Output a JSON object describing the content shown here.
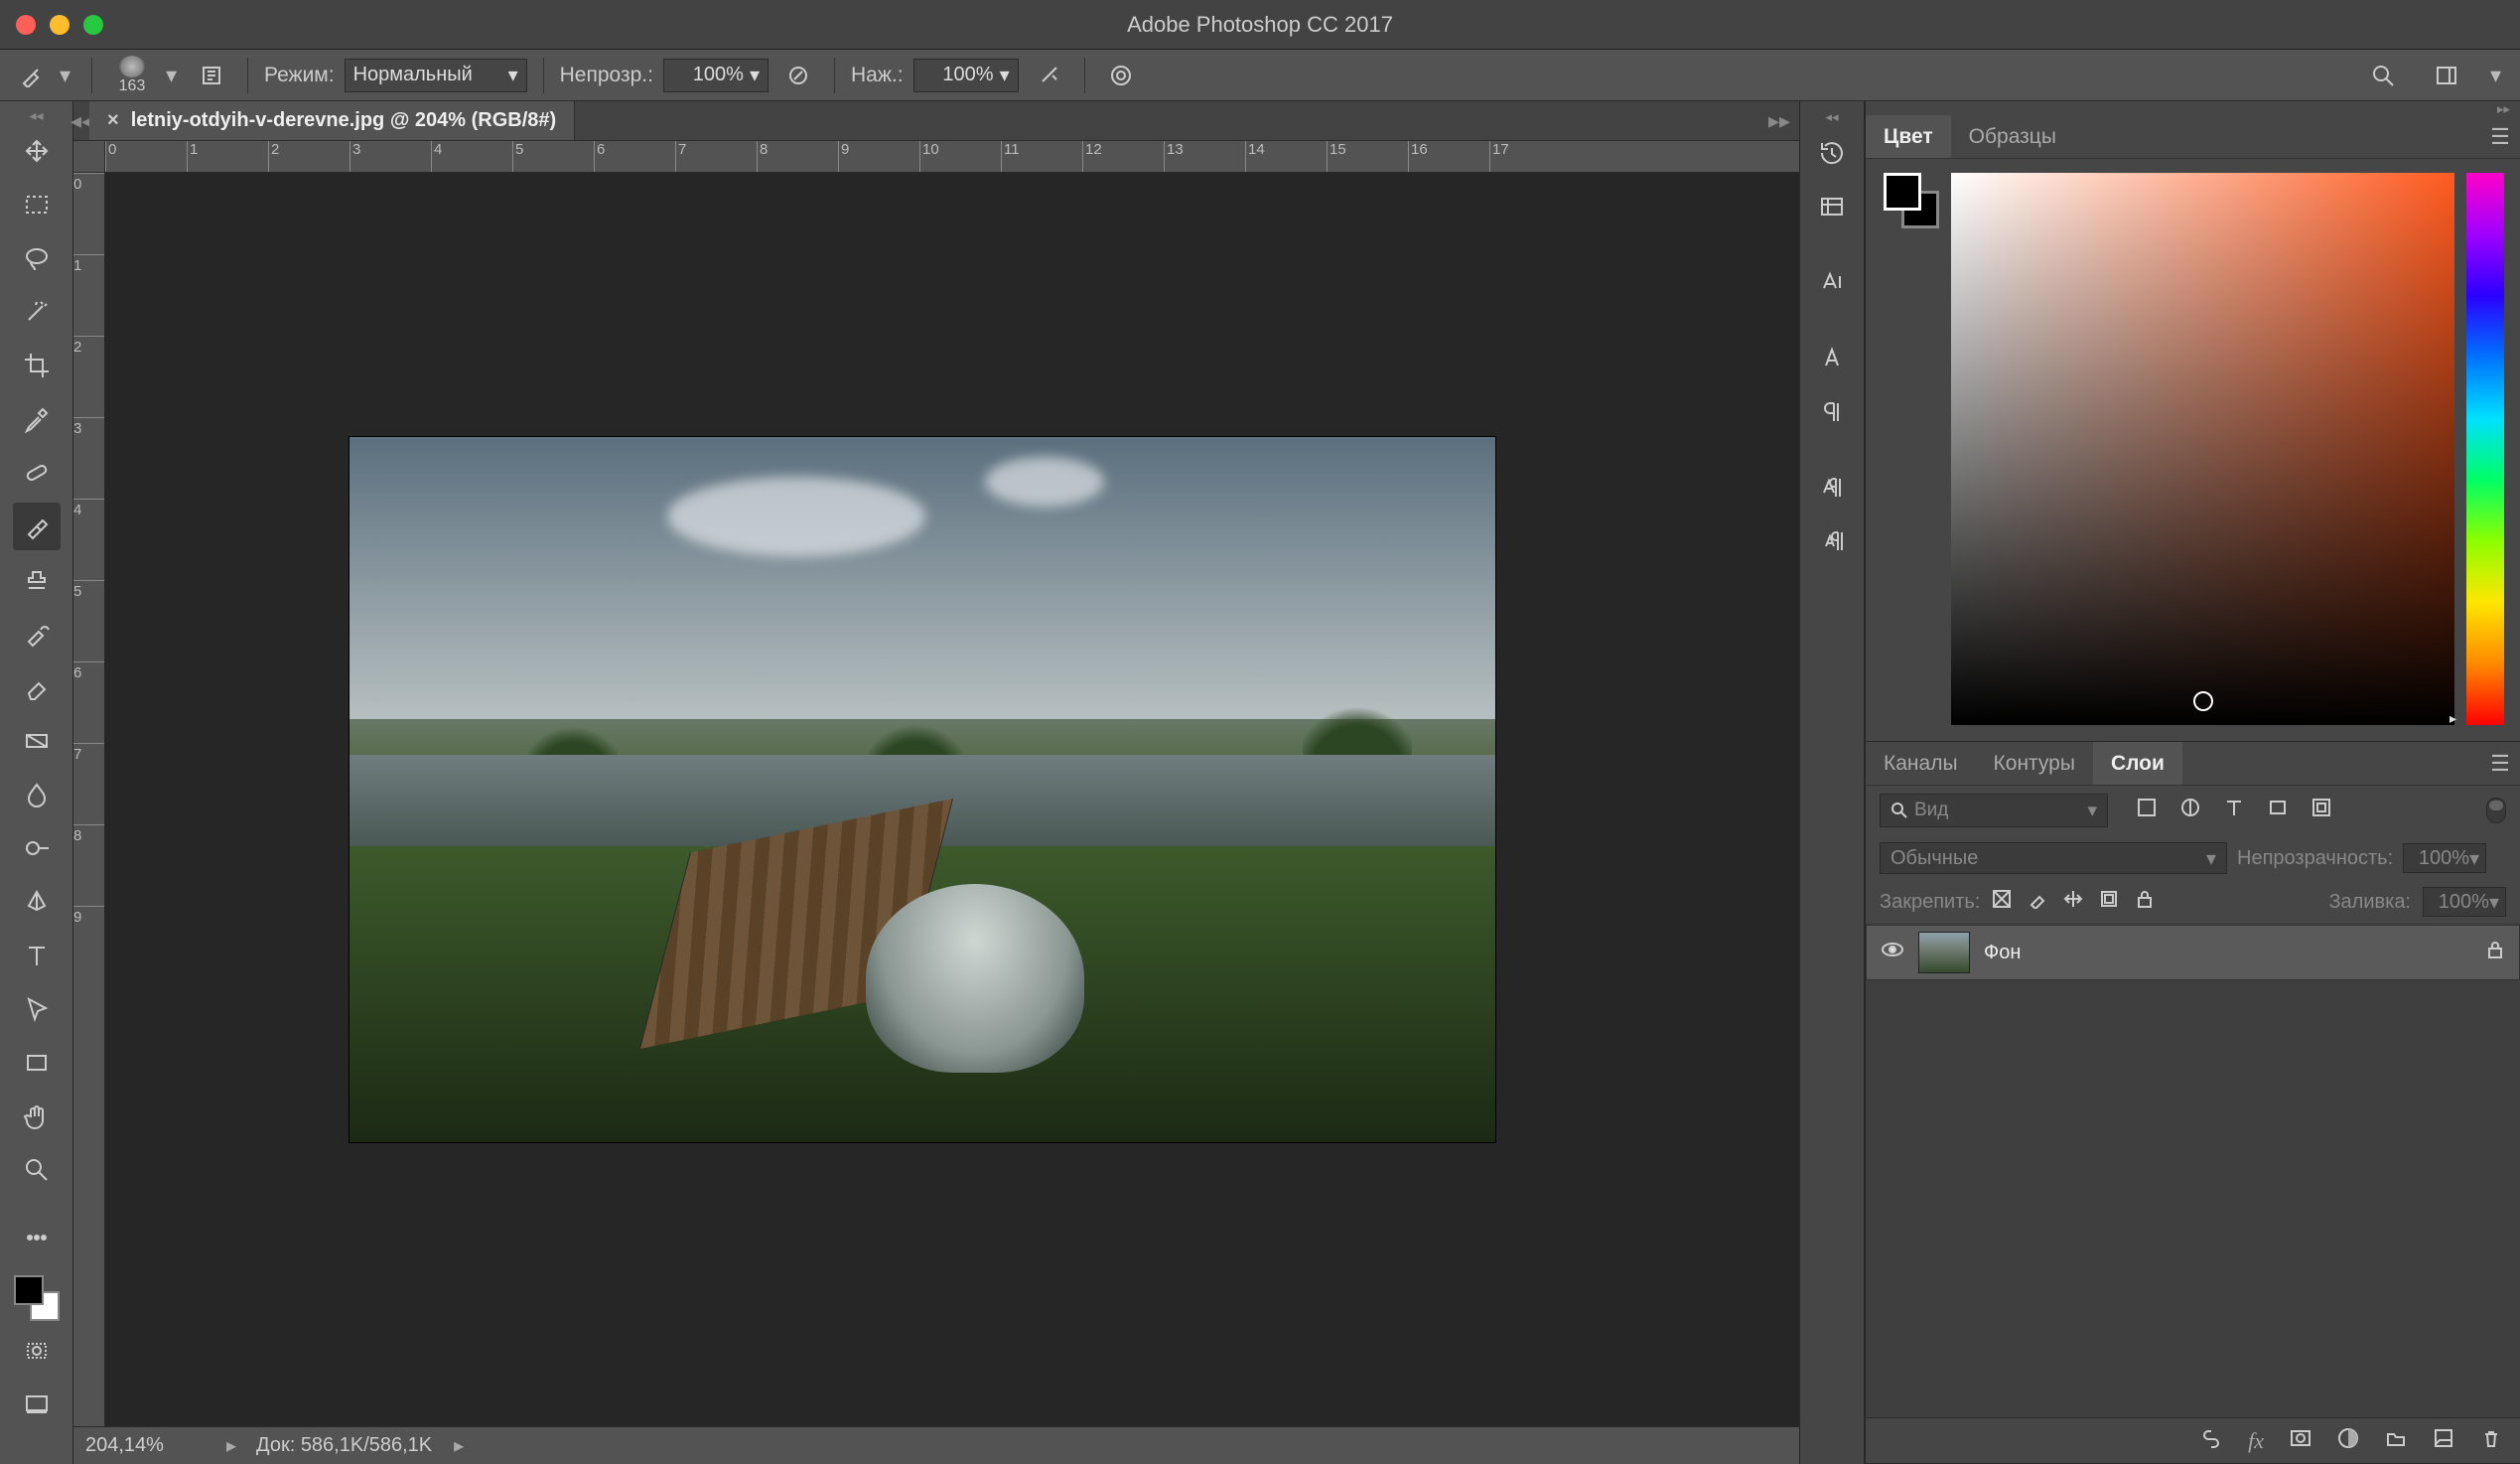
{
  "titlebar": {
    "title": "Adobe Photoshop CC 2017"
  },
  "optionsbar": {
    "brush_size": "163",
    "mode_label": "Режим:",
    "mode_value": "Нормальный",
    "opacity_label": "Непрозр.:",
    "opacity_value": "100%",
    "flow_label": "Наж.:",
    "flow_value": "100%"
  },
  "document": {
    "tab_title": "letniy-otdyih-v-derevne.jpg @ 204% (RGB/8#)",
    "ruler_h": [
      "0",
      "1",
      "2",
      "3",
      "4",
      "5",
      "6",
      "7",
      "8",
      "9",
      "10",
      "11",
      "12",
      "13",
      "14",
      "15",
      "16",
      "17"
    ],
    "ruler_v": [
      "0",
      "1",
      "2",
      "3",
      "4",
      "5",
      "6",
      "7",
      "8",
      "9"
    ]
  },
  "statusbar": {
    "zoom": "204,14%",
    "doc_label": "Док:",
    "doc_value": "586,1K/586,1K"
  },
  "panels": {
    "color": {
      "tab_color": "Цвет",
      "tab_swatches": "Образцы"
    },
    "layers": {
      "tab_channels": "Каналы",
      "tab_paths": "Контуры",
      "tab_layers": "Слои",
      "filter_label": "Вид",
      "blend_mode": "Обычные",
      "opacity_label": "Непрозрачность:",
      "opacity_value": "100%",
      "lock_label": "Закрепить:",
      "fill_label": "Заливка:",
      "fill_value": "100%",
      "items": [
        {
          "name": "Фон",
          "visible": true,
          "locked": true
        }
      ]
    }
  }
}
